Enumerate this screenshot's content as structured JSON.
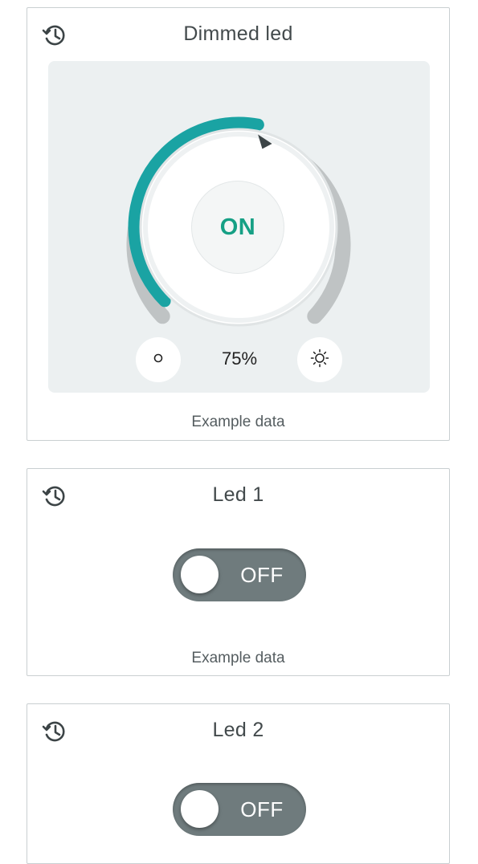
{
  "cards": [
    {
      "title": "Dimmed led",
      "footer": "Example data",
      "dimmer": {
        "state_label": "ON",
        "level_percent": 75,
        "level_text": "75%"
      }
    },
    {
      "title": "Led 1",
      "footer": "Example data",
      "switch": {
        "state_label": "OFF",
        "on": false
      }
    },
    {
      "title": "Led 2",
      "switch": {
        "state_label": "OFF",
        "on": false
      }
    }
  ],
  "icons": {
    "history": "history-icon",
    "min_brightness": "circle-icon",
    "max_brightness": "sun-icon",
    "level_pointer": "triangle-pointer-icon"
  },
  "colors": {
    "accent": "#1aa3a3",
    "on_text": "#16a085",
    "track": "#bfc3c4",
    "panel_bg": "#ecf0f1",
    "toggle_off": "#6f7b7d"
  }
}
